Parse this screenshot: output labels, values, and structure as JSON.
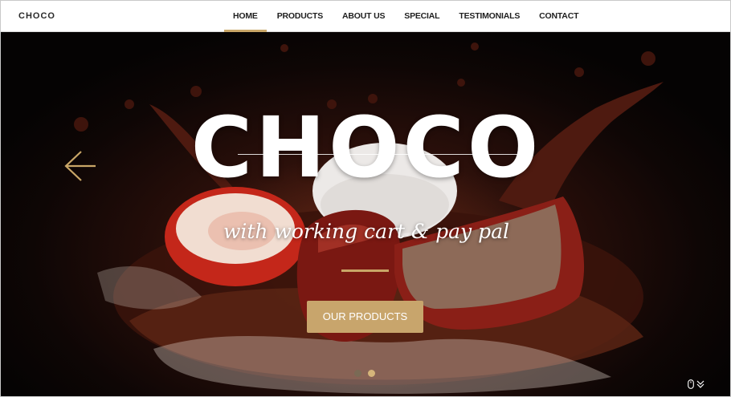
{
  "brand": {
    "logo_text": "CHOCO"
  },
  "nav": {
    "items": [
      {
        "label": "HOME",
        "active": true
      },
      {
        "label": "PRODUCTS",
        "active": false
      },
      {
        "label": "ABOUT US",
        "active": false
      },
      {
        "label": "SPECIAL",
        "active": false
      },
      {
        "label": "TESTIMONIALS",
        "active": false
      },
      {
        "label": "CONTACT",
        "active": false
      }
    ]
  },
  "hero": {
    "title": "CHOCO",
    "subtitle": "with working cart & pay pal",
    "cta_label": "OUR PRODUCTS",
    "slides": {
      "count": 2,
      "active_index": 1
    }
  },
  "colors": {
    "accent_gold": "#c9a667",
    "button_gold": "#c8a56c",
    "nav_text": "#1f1f1f",
    "hero_dark": "#0e0605"
  },
  "icons": {
    "prev": "arrow-left-icon",
    "scroll": "mouse-icon",
    "scroll_chevron": "chevron-double-down-icon"
  }
}
